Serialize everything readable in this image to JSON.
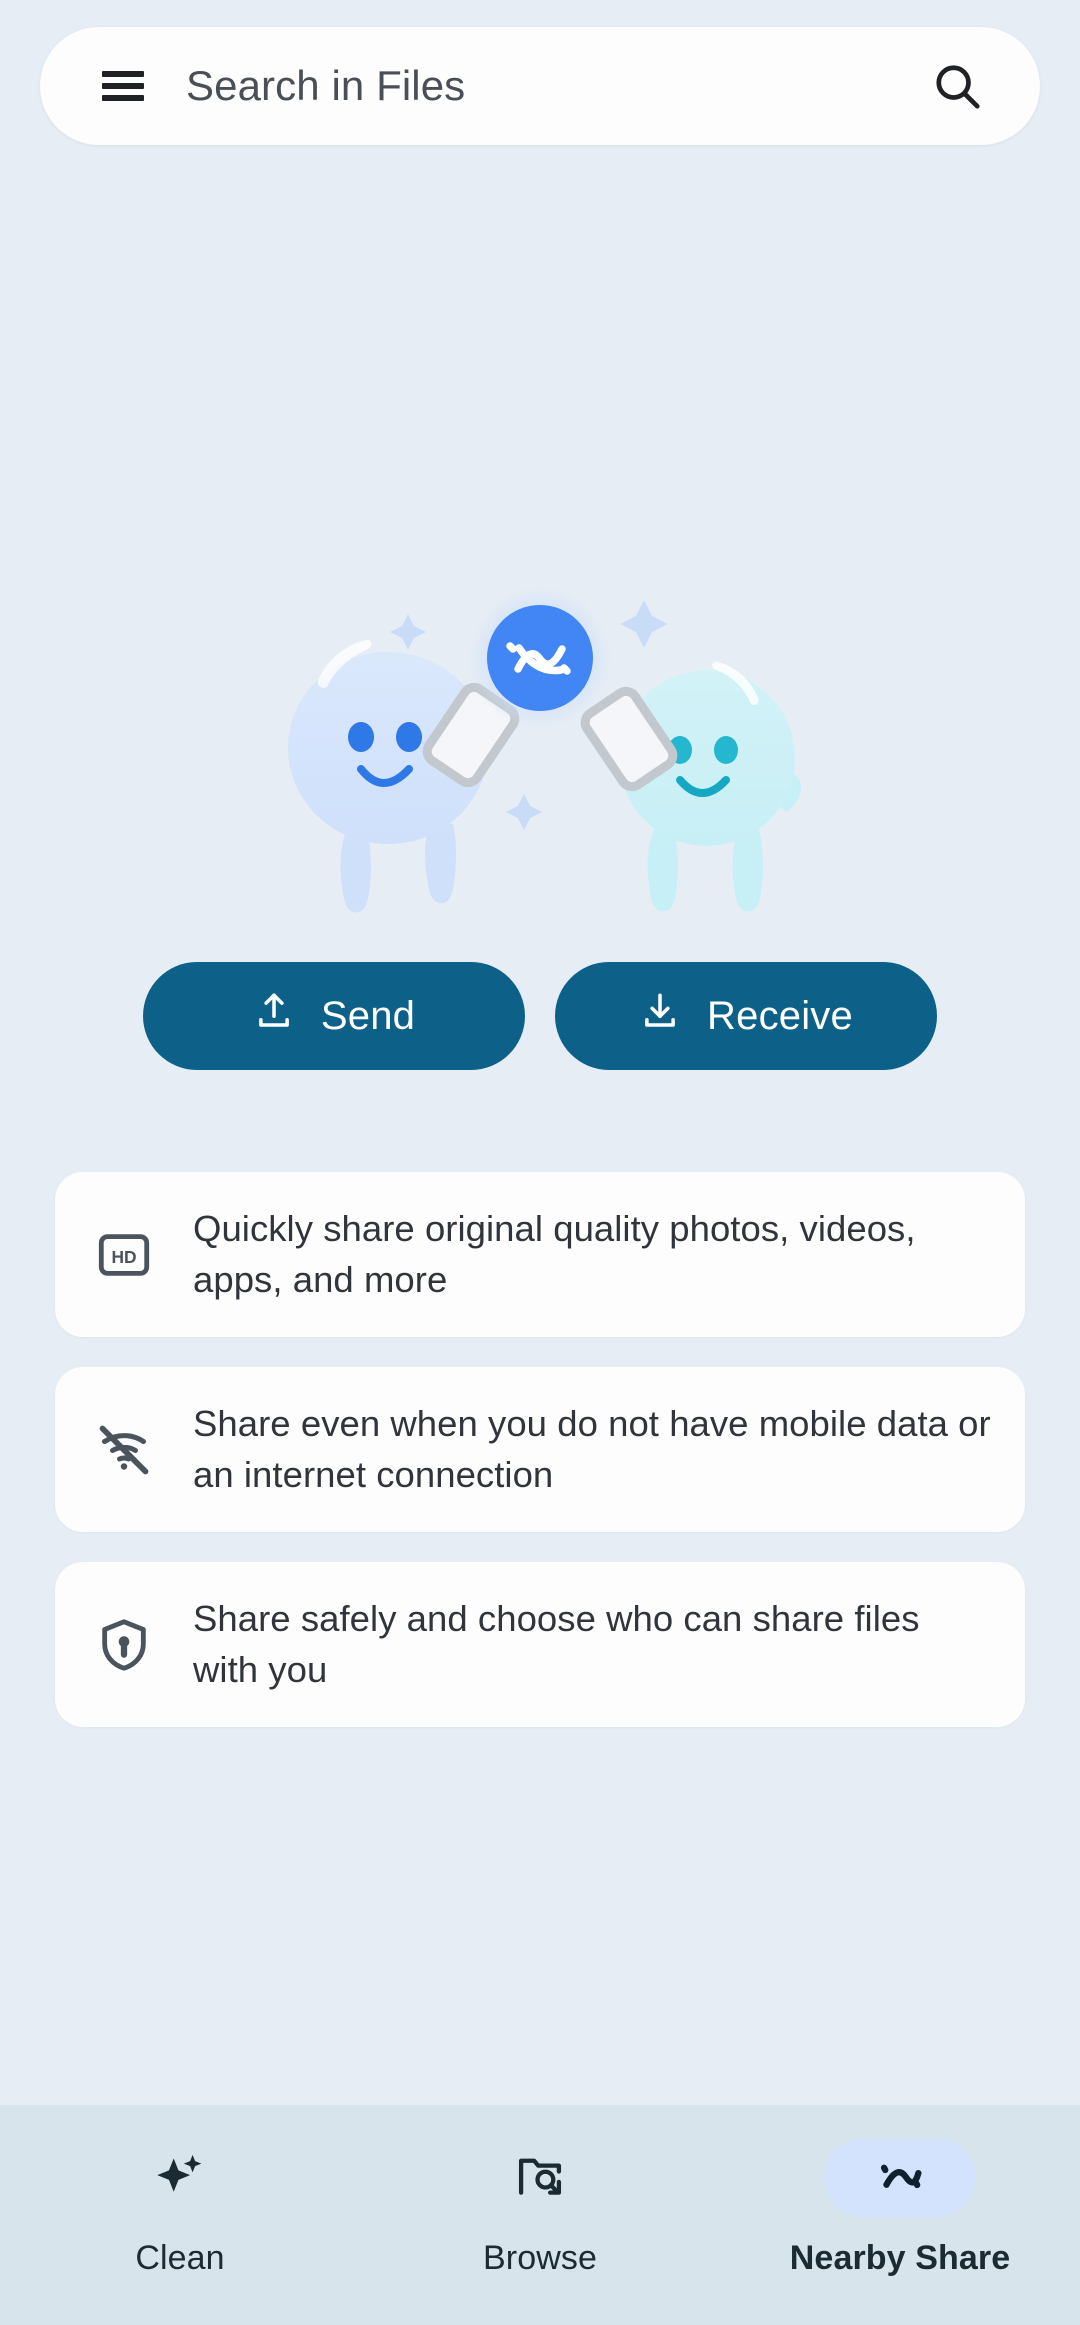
{
  "app": {
    "background_color": "#e7edf4",
    "accent_button_color": "#0d6189",
    "brand_blue": "#4285f4",
    "nav_bar_color": "#d8e4ec",
    "nav_active_pill_color": "#d3e3fd"
  },
  "search": {
    "placeholder": "Search in Files",
    "menu_icon": "hamburger-menu-icon",
    "search_icon": "search-icon"
  },
  "illustration": {
    "name": "nearby-share-blobs-illustration",
    "logo_icon": "nearby-share-logo-icon",
    "left_blob_color": "#d3e3fb",
    "right_blob_color": "#ccf0f5",
    "logo_circle_color": "#4285f4"
  },
  "actions": [
    {
      "label": "Send",
      "icon": "upload-icon",
      "name": "send-button"
    },
    {
      "label": "Receive",
      "icon": "download-icon",
      "name": "receive-button"
    }
  ],
  "info_cards": [
    {
      "icon": "hd-quality-icon",
      "text": "Quickly share original quality photos, videos, apps, and more"
    },
    {
      "icon": "wifi-off-icon",
      "text": "Share even when you do not have mobile data or an internet connection"
    },
    {
      "icon": "shield-lock-icon",
      "text": "Share safely and choose who can share files with you"
    }
  ],
  "bottom_nav": {
    "items": [
      {
        "label": "Clean",
        "icon": "sparkle-icon",
        "active": false
      },
      {
        "label": "Browse",
        "icon": "folder-search-icon",
        "active": false
      },
      {
        "label": "Nearby Share",
        "icon": "nearby-share-icon",
        "active": true
      }
    ]
  }
}
